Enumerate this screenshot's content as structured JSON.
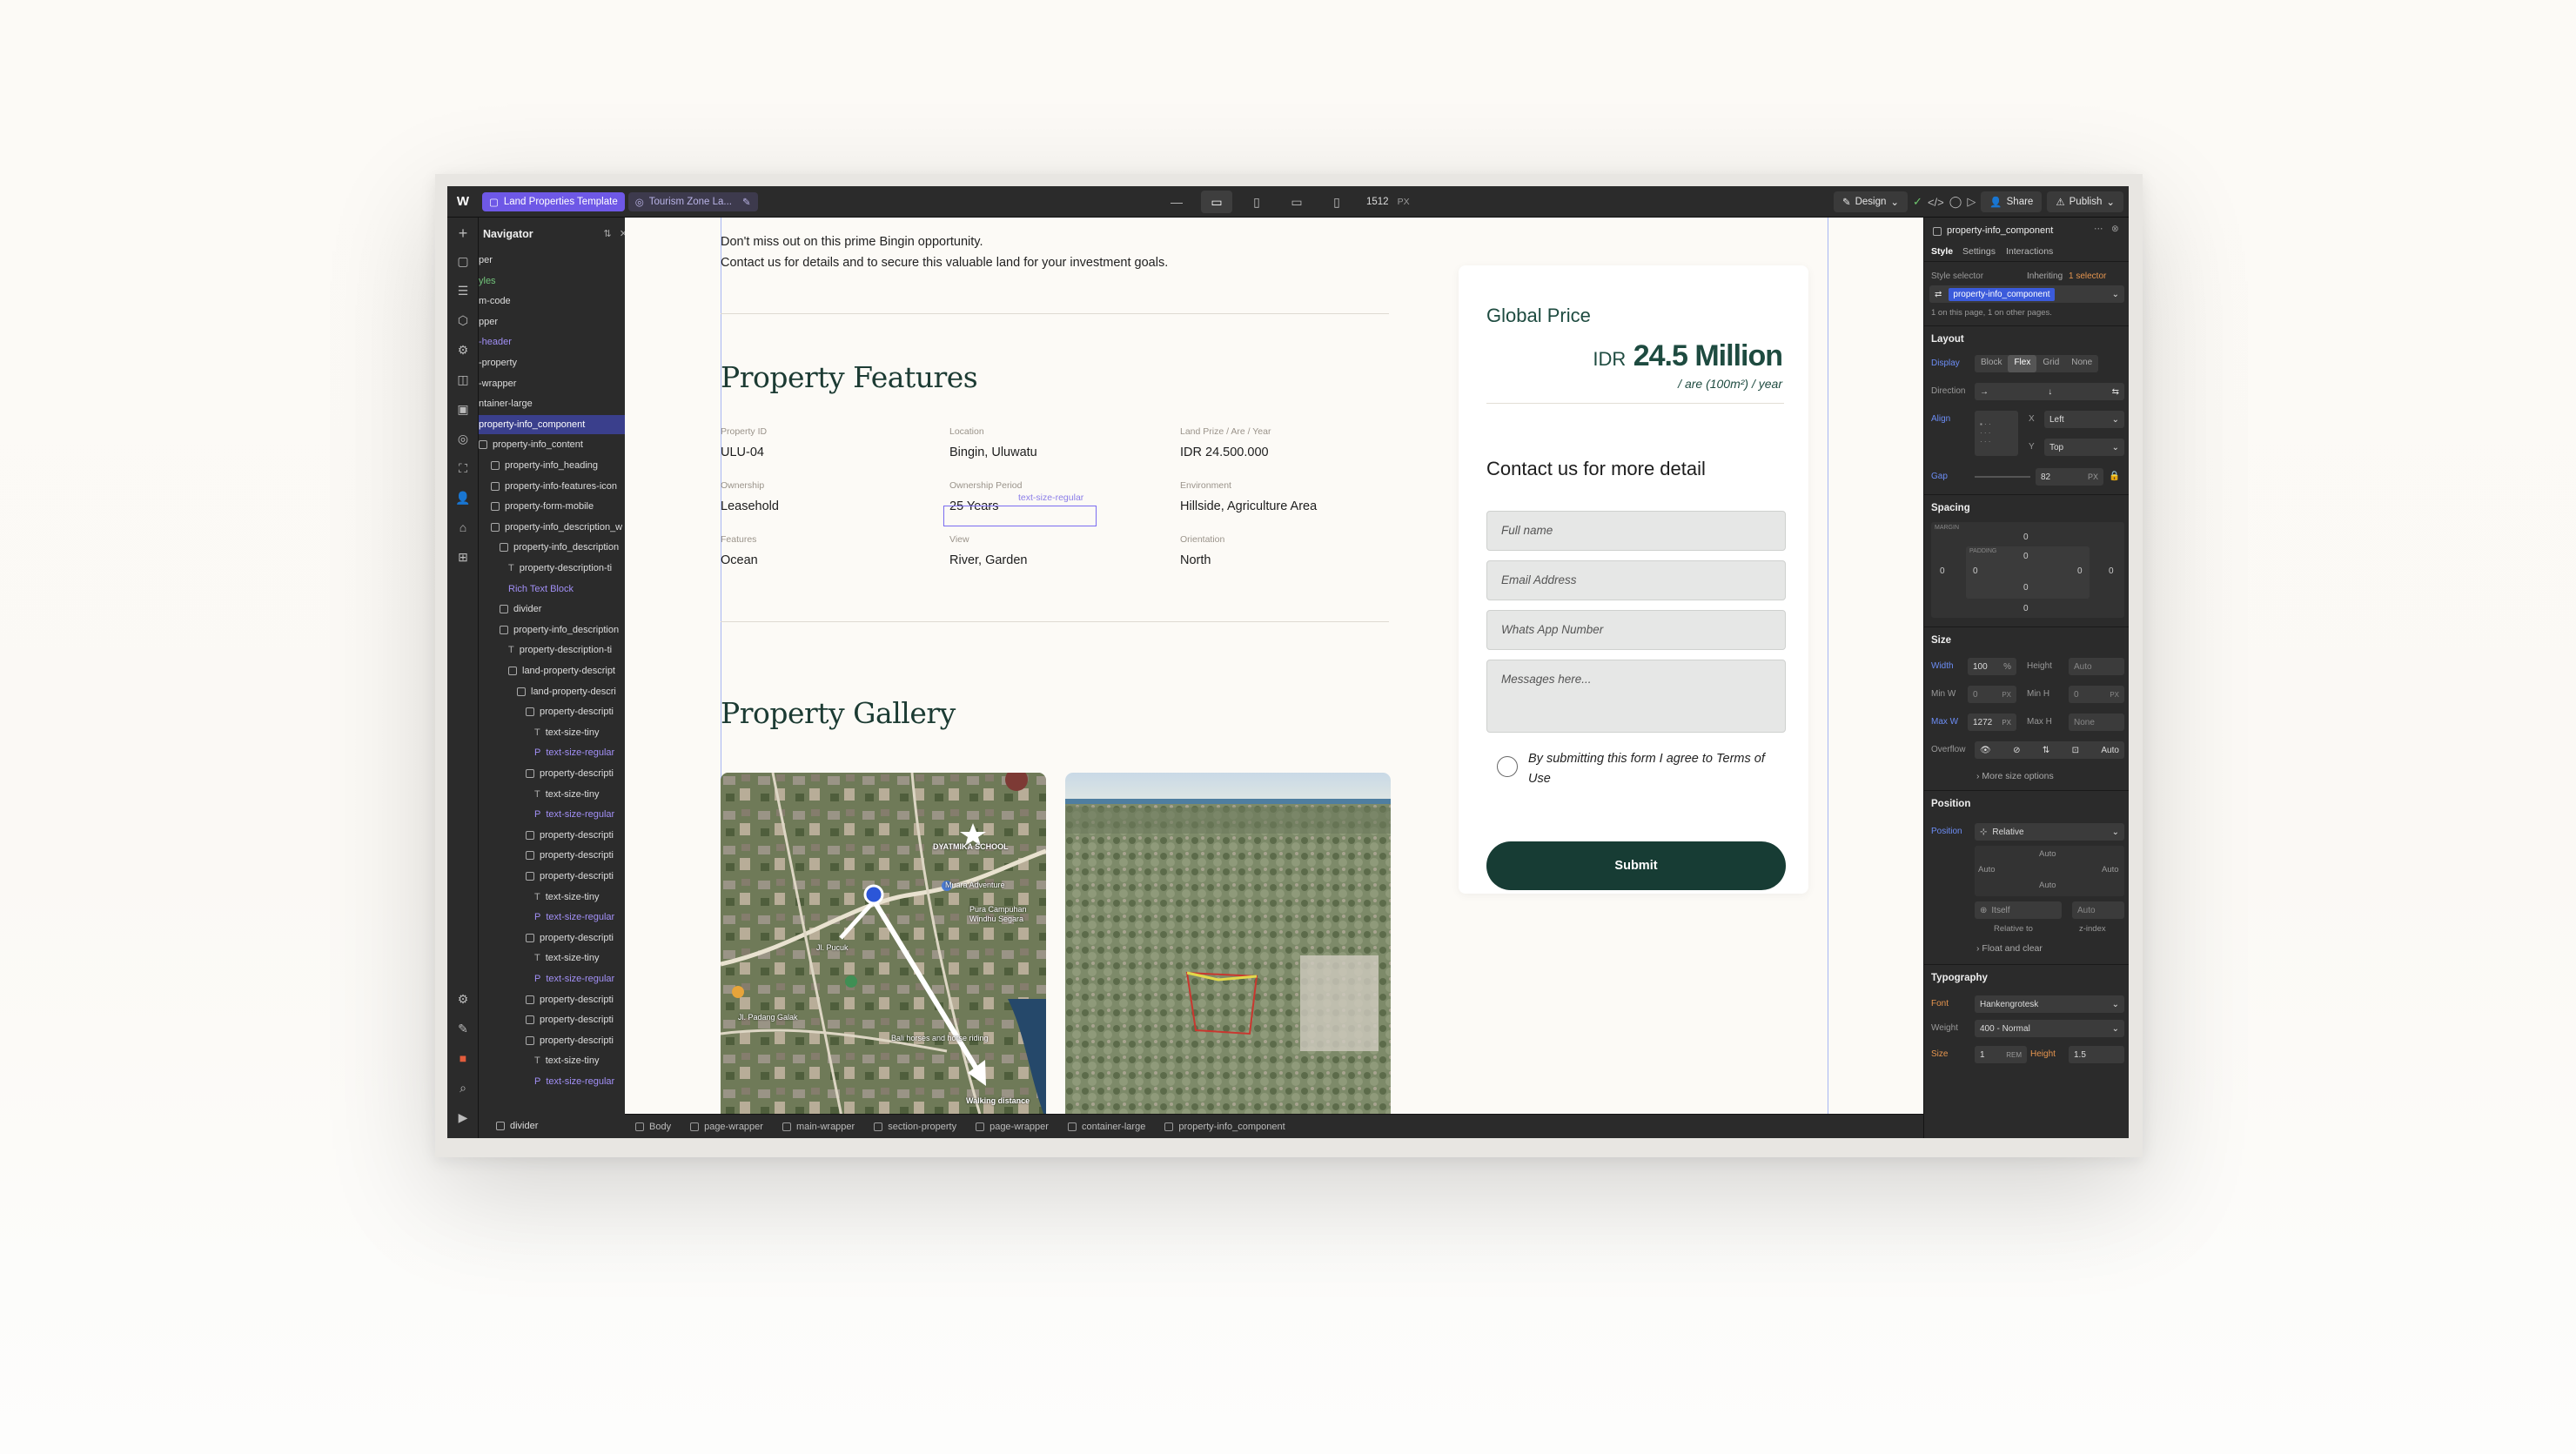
{
  "topbar": {
    "logo": "W",
    "page_tab_active": "Land Properties Template",
    "page_tab_other": "Tourism Zone La...",
    "canvas_width": "1512",
    "canvas_unit": "PX",
    "mode": "Design",
    "share": "Share",
    "publish": "Publish"
  },
  "navigator": {
    "title": "Navigator",
    "items": [
      {
        "label": "per",
        "indent": 0,
        "style": "plain"
      },
      {
        "label": "yles",
        "indent": 0,
        "style": "green"
      },
      {
        "label": "m-code",
        "indent": 0,
        "style": "plain"
      },
      {
        "label": "pper",
        "indent": 0,
        "style": "plain"
      },
      {
        "label": "-header",
        "indent": 0,
        "style": "purple"
      },
      {
        "label": "-property",
        "indent": 0,
        "style": "plain"
      },
      {
        "label": "-wrapper",
        "indent": 0,
        "style": "plain"
      },
      {
        "label": "ntainer-large",
        "indent": 0,
        "style": "plain"
      },
      {
        "label": "property-info_component",
        "indent": 0,
        "style": "selected"
      },
      {
        "label": "property-info_content",
        "indent": 0,
        "style": "box"
      },
      {
        "label": "property-info_heading",
        "indent": 1,
        "style": "box"
      },
      {
        "label": "property-info-features-icon",
        "indent": 1,
        "style": "box"
      },
      {
        "label": "property-form-mobile",
        "indent": 1,
        "style": "box"
      },
      {
        "label": "property-info_description_w",
        "indent": 1,
        "style": "box"
      },
      {
        "label": "property-info_description",
        "indent": 2,
        "style": "box"
      },
      {
        "label": "property-description-ti",
        "indent": 3,
        "style": "text"
      },
      {
        "label": "Rich Text Block",
        "indent": 3,
        "style": "purple"
      },
      {
        "label": "divider",
        "indent": 2,
        "style": "box"
      },
      {
        "label": "property-info_description",
        "indent": 2,
        "style": "box"
      },
      {
        "label": "property-description-ti",
        "indent": 3,
        "style": "text"
      },
      {
        "label": "land-property-descript",
        "indent": 3,
        "style": "box"
      },
      {
        "label": "land-property-descri",
        "indent": 4,
        "style": "box"
      },
      {
        "label": "property-descripti",
        "indent": 5,
        "style": "box"
      },
      {
        "label": "text-size-tiny",
        "indent": 6,
        "style": "text"
      },
      {
        "label": "text-size-regular",
        "indent": 6,
        "style": "ptext"
      },
      {
        "label": "property-descripti",
        "indent": 5,
        "style": "box"
      },
      {
        "label": "text-size-tiny",
        "indent": 6,
        "style": "text"
      },
      {
        "label": "text-size-regular",
        "indent": 6,
        "style": "ptext"
      },
      {
        "label": "property-descripti",
        "indent": 5,
        "style": "box"
      },
      {
        "label": "property-descripti",
        "indent": 5,
        "style": "box"
      },
      {
        "label": "property-descripti",
        "indent": 5,
        "style": "box"
      },
      {
        "label": "text-size-tiny",
        "indent": 6,
        "style": "text"
      },
      {
        "label": "text-size-regular",
        "indent": 6,
        "style": "ptext"
      },
      {
        "label": "property-descripti",
        "indent": 5,
        "style": "box"
      },
      {
        "label": "text-size-tiny",
        "indent": 6,
        "style": "text"
      },
      {
        "label": "text-size-regular",
        "indent": 6,
        "style": "ptext"
      },
      {
        "label": "property-descripti",
        "indent": 5,
        "style": "box"
      },
      {
        "label": "property-descripti",
        "indent": 5,
        "style": "box"
      },
      {
        "label": "property-descripti",
        "indent": 5,
        "style": "box"
      },
      {
        "label": "text-size-tiny",
        "indent": 6,
        "style": "text"
      },
      {
        "label": "text-size-regular",
        "indent": 6,
        "style": "ptext"
      }
    ],
    "footer_item": "divider"
  },
  "canvas": {
    "intro_line1": "Don't miss out on this prime Bingin opportunity.",
    "intro_line2": "Contact us for details and to secure this valuable land for your investment goals.",
    "features_heading": "Property Features",
    "features": [
      {
        "label": "Property ID",
        "value": "ULU-04"
      },
      {
        "label": "Location",
        "value": "Bingin, Uluwatu"
      },
      {
        "label": "Land Prize / Are / Year",
        "value": "IDR 24.500.000"
      },
      {
        "label": "Ownership",
        "value": "Leasehold"
      },
      {
        "label": "Ownership Period",
        "value": "25 Years"
      },
      {
        "label": "Environment",
        "value": "Hillside, Agriculture Area"
      },
      {
        "label": "Features",
        "value": "Ocean"
      },
      {
        "label": "View",
        "value": "River, Garden"
      },
      {
        "label": "Orientation",
        "value": "North"
      }
    ],
    "hover_class_label": "text-size-regular",
    "gallery_heading": "Property Gallery",
    "map_labels": [
      "DYATMIKA SCHOOL",
      "Muara Adventure",
      "Pura Campuhan Windhu Segara",
      "Bali horses and horse riding",
      "Jl. Padang Galak",
      "Jl. Pucuk",
      "Walking distance"
    ]
  },
  "card": {
    "global_price_label": "Global Price",
    "currency": "IDR",
    "price": "24.5 Million",
    "unit": "/ are (100m²) / year",
    "contact_title": "Contact us for more detail",
    "fields": {
      "full_name": "Full name",
      "email": "Email Address",
      "whatsapp": "Whats App Number",
      "message": "Messages here..."
    },
    "terms": "By submitting this form I agree to Terms of Use",
    "submit": "Submit"
  },
  "breadcrumbs": [
    "Body",
    "page-wrapper",
    "main-wrapper",
    "section-property",
    "page-wrapper",
    "container-large",
    "property-info_component"
  ],
  "style_panel": {
    "element": "property-info_component",
    "tabs": [
      "Style",
      "Settings",
      "Interactions"
    ],
    "style_selector_label": "Style selector",
    "inheriting": "Inheriting",
    "inheriting_count": "1 selector",
    "selector_chip": "property-info_component",
    "usage_note": "1 on this page, 1 on other pages.",
    "layout": {
      "title": "Layout",
      "display_label": "Display",
      "display_options": [
        "Block",
        "Flex",
        "Grid",
        "None"
      ],
      "display_selected": "Flex",
      "direction_label": "Direction",
      "align_label": "Align",
      "x_label": "X",
      "x_value": "Left",
      "y_label": "Y",
      "y_value": "Top",
      "gap_label": "Gap",
      "gap_value": "82",
      "gap_unit": "PX"
    },
    "spacing": {
      "title": "Spacing",
      "margin_label": "MARGIN",
      "padding_label": "PADDING",
      "values": [
        "0",
        "0",
        "0",
        "0",
        "0",
        "0",
        "0",
        "0"
      ]
    },
    "size": {
      "title": "Size",
      "width_label": "Width",
      "width_value": "100",
      "width_unit": "%",
      "height_label": "Height",
      "height_value": "Auto",
      "minw_label": "Min W",
      "minw_value": "0",
      "minh_label": "Min H",
      "minh_value": "0",
      "unit_px": "PX",
      "maxw_label": "Max W",
      "maxw_value": "1272",
      "maxh_label": "Max H",
      "maxh_value": "None",
      "overflow_label": "Overflow",
      "overflow_value": "Auto",
      "more": "More size options"
    },
    "position": {
      "title": "Position",
      "label": "Position",
      "value": "Relative",
      "auto": "Auto",
      "itself": "Itself",
      "relative_to": "Relative to",
      "z_index": "z-index",
      "float": "Float and clear"
    },
    "typography": {
      "title": "Typography",
      "font_label": "Font",
      "font_value": "Hankengrotesk",
      "weight_label": "Weight",
      "weight_value": "400 - Normal",
      "size_label": "Size",
      "size_value": "1",
      "size_unit": "REM",
      "height_label": "Height",
      "height_value": "1.5"
    }
  }
}
